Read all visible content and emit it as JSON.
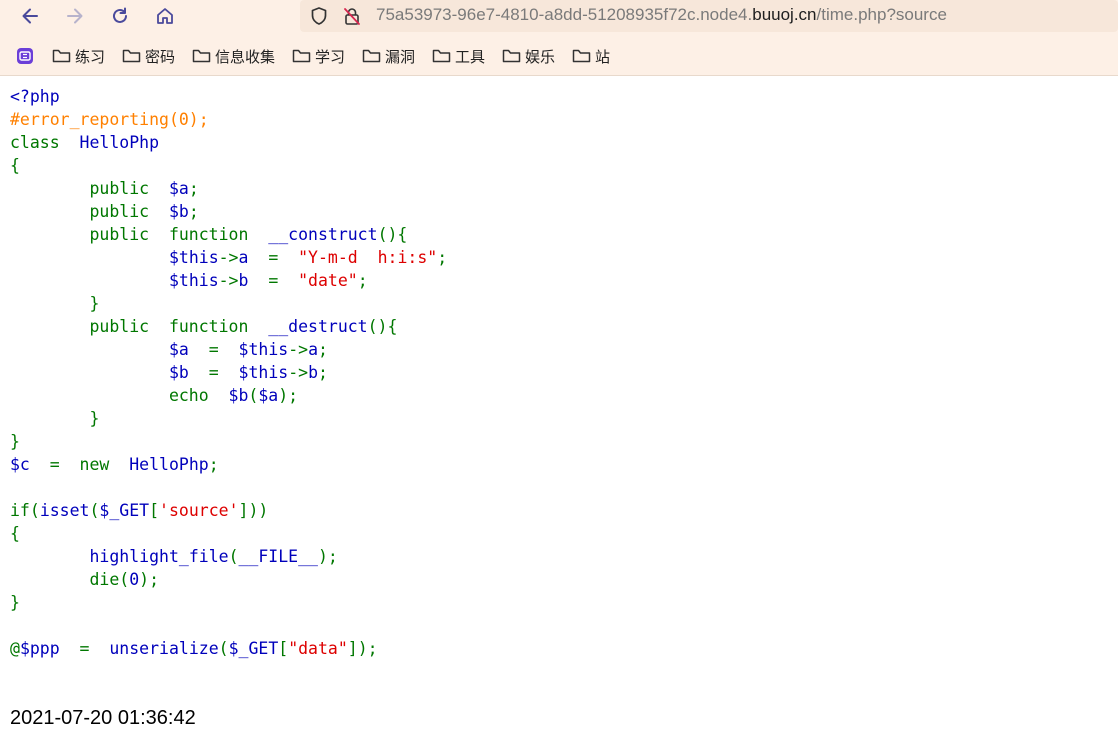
{
  "browser": {
    "url_prefix": "75a53973-96e7-4810-a8dd-51208935f72c.node4.",
    "url_host": "buuoj.cn",
    "url_suffix": "/time.php?source",
    "bookmarks": [
      "练习",
      "密码",
      "信息收集",
      "学习",
      "漏洞",
      "工具",
      "娱乐",
      "站"
    ]
  },
  "code_lines": [
    [
      {
        "t": "<?php",
        "c": "html"
      }
    ],
    [
      {
        "t": "#error_reporting(0);",
        "c": "comment"
      }
    ],
    [
      {
        "t": "class",
        "c": "keyword"
      },
      {
        "t": "  HelloPhp",
        "c": "default"
      }
    ],
    [
      {
        "t": "{",
        "c": "keyword"
      }
    ],
    [
      {
        "t": "        public  ",
        "c": "keyword"
      },
      {
        "t": "$a",
        "c": "default"
      },
      {
        "t": ";",
        "c": "keyword"
      }
    ],
    [
      {
        "t": "        public  ",
        "c": "keyword"
      },
      {
        "t": "$b",
        "c": "default"
      },
      {
        "t": ";",
        "c": "keyword"
      }
    ],
    [
      {
        "t": "        public  function  ",
        "c": "keyword"
      },
      {
        "t": "__construct",
        "c": "default"
      },
      {
        "t": "(){",
        "c": "keyword"
      }
    ],
    [
      {
        "t": "                ",
        "c": "keyword"
      },
      {
        "t": "$this",
        "c": "default"
      },
      {
        "t": "->",
        "c": "keyword"
      },
      {
        "t": "a  ",
        "c": "default"
      },
      {
        "t": "=  ",
        "c": "keyword"
      },
      {
        "t": "\"Y-m-d  h:i:s\"",
        "c": "string"
      },
      {
        "t": ";",
        "c": "keyword"
      }
    ],
    [
      {
        "t": "                ",
        "c": "keyword"
      },
      {
        "t": "$this",
        "c": "default"
      },
      {
        "t": "->",
        "c": "keyword"
      },
      {
        "t": "b  ",
        "c": "default"
      },
      {
        "t": "=  ",
        "c": "keyword"
      },
      {
        "t": "\"date\"",
        "c": "string"
      },
      {
        "t": ";",
        "c": "keyword"
      }
    ],
    [
      {
        "t": "        }",
        "c": "keyword"
      }
    ],
    [
      {
        "t": "        public  function  ",
        "c": "keyword"
      },
      {
        "t": "__destruct",
        "c": "default"
      },
      {
        "t": "(){",
        "c": "keyword"
      }
    ],
    [
      {
        "t": "                ",
        "c": "keyword"
      },
      {
        "t": "$a  ",
        "c": "default"
      },
      {
        "t": "=  ",
        "c": "keyword"
      },
      {
        "t": "$this",
        "c": "default"
      },
      {
        "t": "->",
        "c": "keyword"
      },
      {
        "t": "a",
        "c": "default"
      },
      {
        "t": ";",
        "c": "keyword"
      }
    ],
    [
      {
        "t": "                ",
        "c": "keyword"
      },
      {
        "t": "$b  ",
        "c": "default"
      },
      {
        "t": "=  ",
        "c": "keyword"
      },
      {
        "t": "$this",
        "c": "default"
      },
      {
        "t": "->",
        "c": "keyword"
      },
      {
        "t": "b",
        "c": "default"
      },
      {
        "t": ";",
        "c": "keyword"
      }
    ],
    [
      {
        "t": "                echo  ",
        "c": "keyword"
      },
      {
        "t": "$b",
        "c": "default"
      },
      {
        "t": "(",
        "c": "keyword"
      },
      {
        "t": "$a",
        "c": "default"
      },
      {
        "t": ");",
        "c": "keyword"
      }
    ],
    [
      {
        "t": "        }",
        "c": "keyword"
      }
    ],
    [
      {
        "t": "}",
        "c": "keyword"
      }
    ],
    [
      {
        "t": "$c  ",
        "c": "default"
      },
      {
        "t": "=  new  ",
        "c": "keyword"
      },
      {
        "t": "HelloPhp",
        "c": "default"
      },
      {
        "t": ";",
        "c": "keyword"
      }
    ],
    [
      {
        "t": "",
        "c": "keyword"
      }
    ],
    [
      {
        "t": "if(",
        "c": "keyword"
      },
      {
        "t": "isset",
        "c": "default"
      },
      {
        "t": "(",
        "c": "keyword"
      },
      {
        "t": "$_GET",
        "c": "default"
      },
      {
        "t": "[",
        "c": "keyword"
      },
      {
        "t": "'source'",
        "c": "string"
      },
      {
        "t": "]))",
        "c": "keyword"
      }
    ],
    [
      {
        "t": "{",
        "c": "keyword"
      }
    ],
    [
      {
        "t": "        ",
        "c": "keyword"
      },
      {
        "t": "highlight_file",
        "c": "default"
      },
      {
        "t": "(",
        "c": "keyword"
      },
      {
        "t": "__FILE__",
        "c": "default"
      },
      {
        "t": ");",
        "c": "keyword"
      }
    ],
    [
      {
        "t": "        die(",
        "c": "keyword"
      },
      {
        "t": "0",
        "c": "default"
      },
      {
        "t": ");",
        "c": "keyword"
      }
    ],
    [
      {
        "t": "}",
        "c": "keyword"
      }
    ],
    [
      {
        "t": "",
        "c": "keyword"
      }
    ],
    [
      {
        "t": "@",
        "c": "keyword"
      },
      {
        "t": "$ppp  ",
        "c": "default"
      },
      {
        "t": "=  ",
        "c": "keyword"
      },
      {
        "t": "unserialize",
        "c": "default"
      },
      {
        "t": "(",
        "c": "keyword"
      },
      {
        "t": "$_GET",
        "c": "default"
      },
      {
        "t": "[",
        "c": "keyword"
      },
      {
        "t": "\"data\"",
        "c": "string"
      },
      {
        "t": "]);",
        "c": "keyword"
      }
    ]
  ],
  "output_text": "2021-07-20 01:36:42"
}
